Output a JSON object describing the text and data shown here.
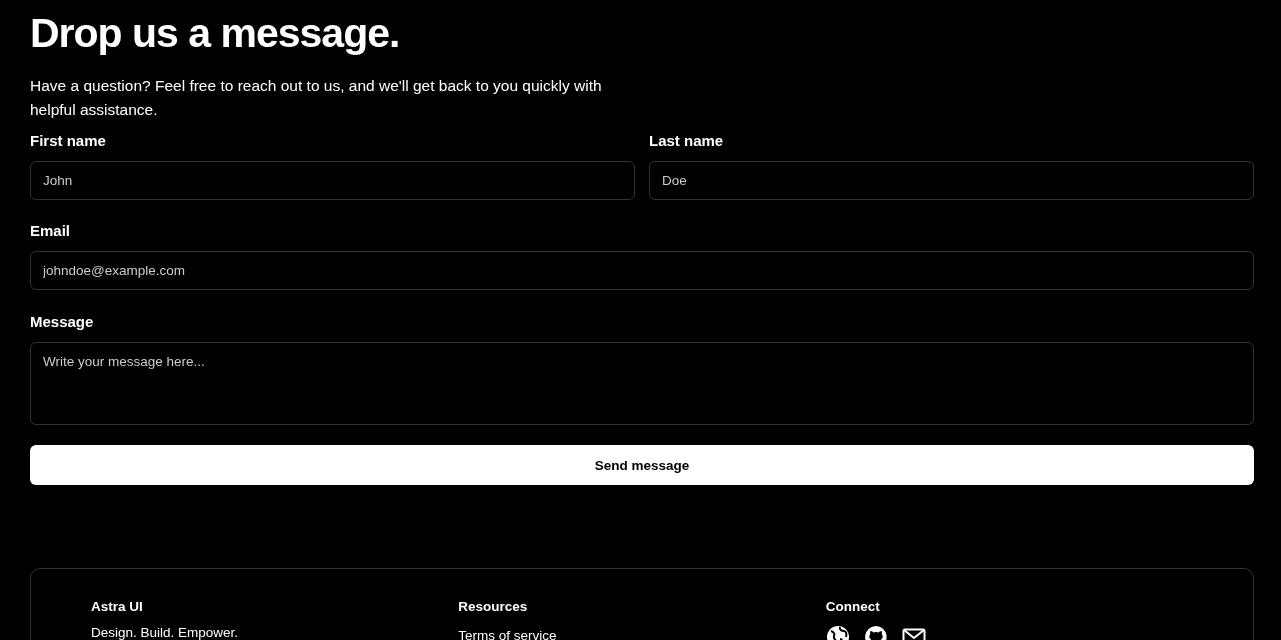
{
  "heading": "Drop us a message.",
  "description": "Have a question? Feel free to reach out to us, and we'll get back to you quickly with helpful assistance.",
  "fields": [
    {
      "label": "First name",
      "placeholder": "John",
      "kind": "input"
    },
    {
      "label": "Last name",
      "placeholder": "Doe",
      "kind": "input"
    },
    {
      "label": "Email",
      "placeholder": "johndoe@example.com",
      "kind": "input"
    },
    {
      "label": "Message",
      "placeholder": "Write your message here...",
      "kind": "textarea"
    }
  ],
  "submit": "Send message",
  "footer": {
    "columns": [
      {
        "title": "Astra UI",
        "kind": "text",
        "text": "Design. Build. Empower."
      },
      {
        "title": "Resources",
        "kind": "links",
        "links": [
          "Terms of service"
        ]
      },
      {
        "title": "Connect",
        "kind": "icons",
        "icons": [
          {
            "kind": "globe"
          },
          {
            "kind": "cat"
          },
          {
            "kind": "envelope"
          }
        ]
      }
    ]
  }
}
